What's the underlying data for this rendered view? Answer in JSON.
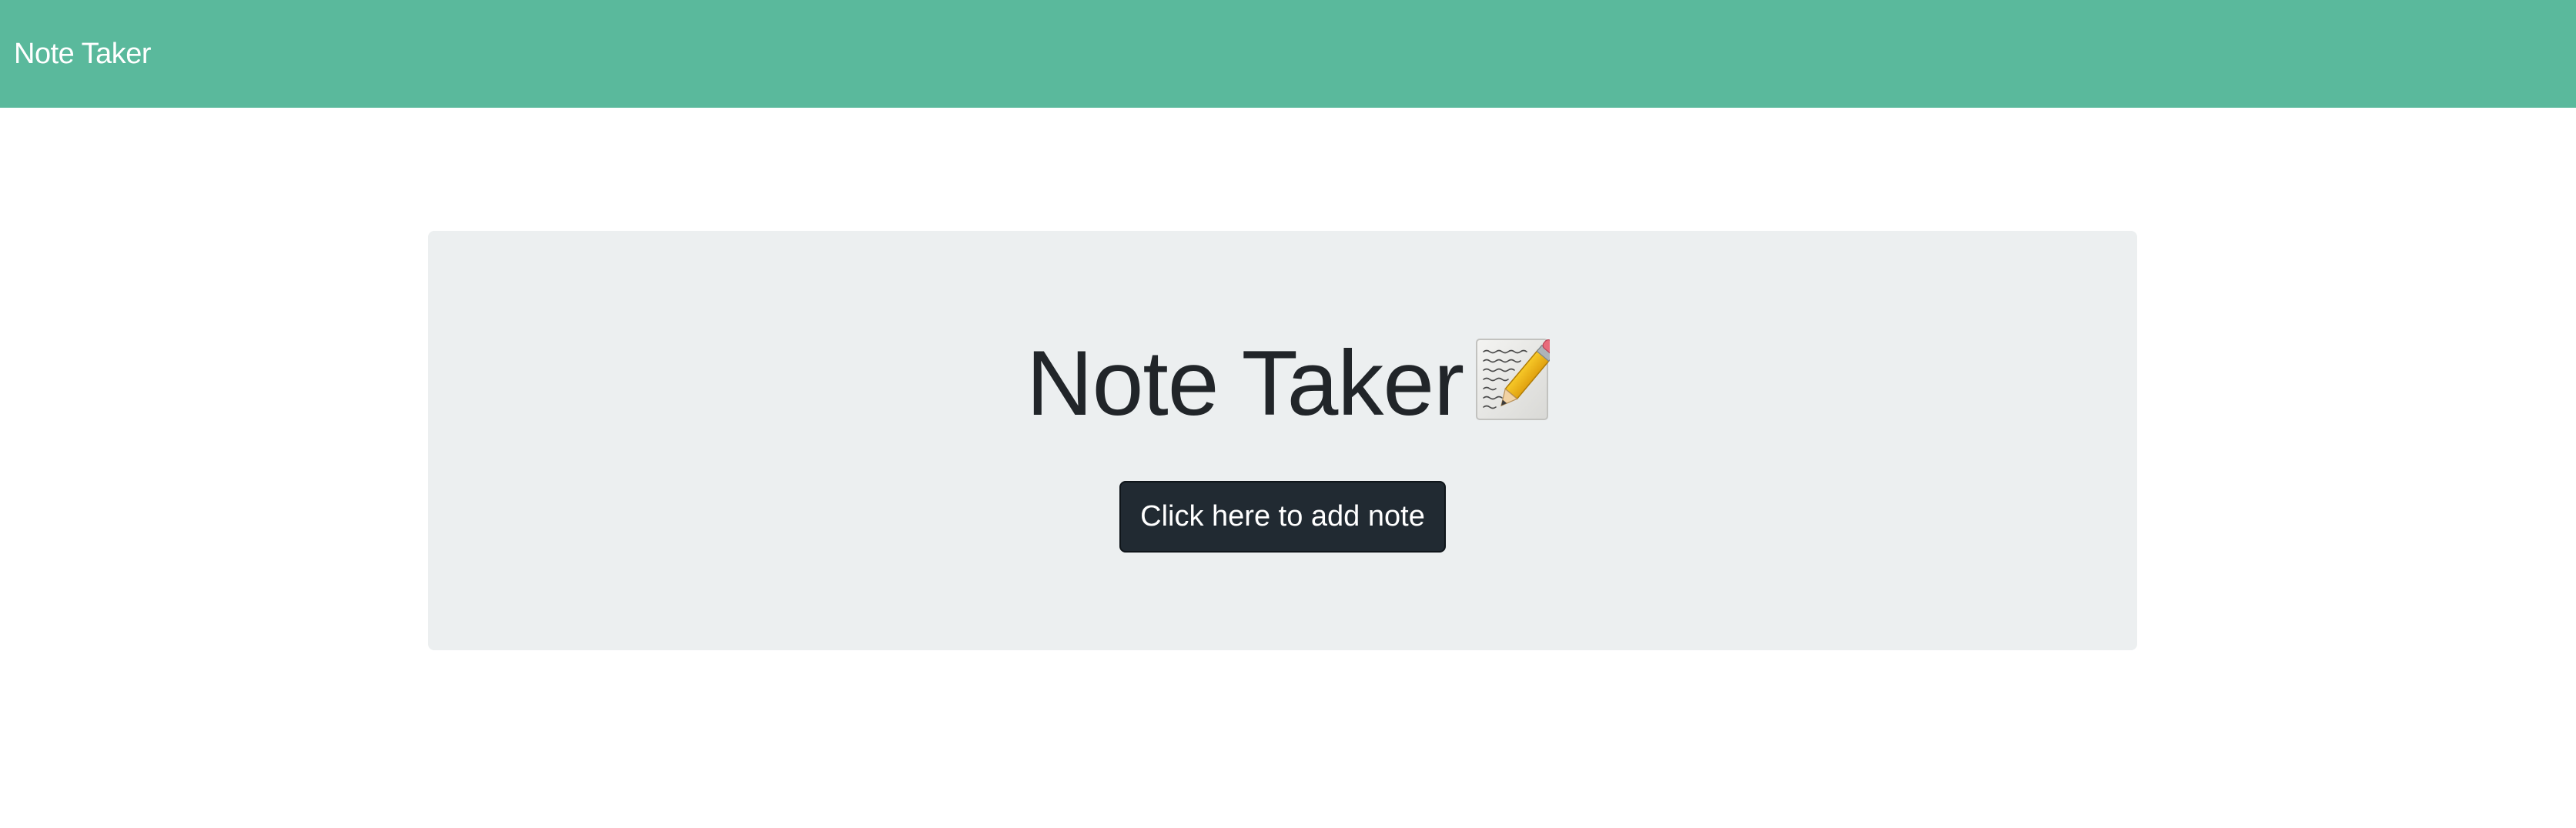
{
  "navbar": {
    "brand": "Note Taker"
  },
  "hero": {
    "title": "Note Taker",
    "title_icon": "memo-icon",
    "button_label": "Click here to add note"
  },
  "colors": {
    "navbar": "#5ab99c",
    "jumbotron": "#eceff0",
    "button": "#212a32",
    "title_text": "#212529"
  }
}
